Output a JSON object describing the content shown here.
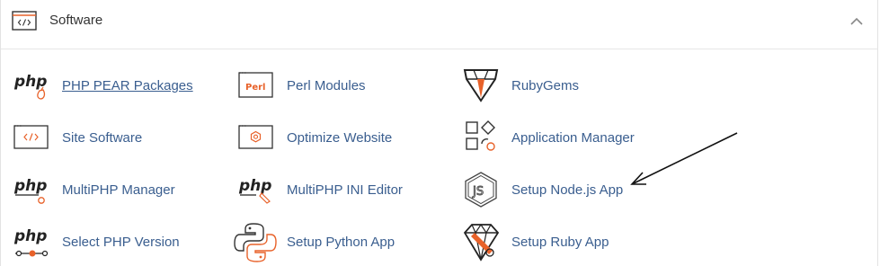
{
  "section": {
    "title": "Software",
    "icon": "code-window-icon",
    "collapse_icon": "chevron-up-icon"
  },
  "colors": {
    "link": "#3a5e8f",
    "accent": "#e8622a",
    "icon_dark": "#333333"
  },
  "items": [
    {
      "label": "PHP PEAR Packages",
      "icon": "php-pear-icon"
    },
    {
      "label": "Perl Modules",
      "icon": "perl-icon",
      "icon_text": "Perl"
    },
    {
      "label": "RubyGems",
      "icon": "rubygems-icon"
    },
    {
      "label": "Site Software",
      "icon": "site-software-icon"
    },
    {
      "label": "Optimize Website",
      "icon": "optimize-website-icon"
    },
    {
      "label": "Application Manager",
      "icon": "application-manager-icon"
    },
    {
      "label": "MultiPHP Manager",
      "icon": "multiphp-manager-icon"
    },
    {
      "label": "MultiPHP INI Editor",
      "icon": "multiphp-ini-icon"
    },
    {
      "label": "Setup Node.js App",
      "icon": "nodejs-icon"
    },
    {
      "label": "Select PHP Version",
      "icon": "select-php-icon"
    },
    {
      "label": "Setup Python App",
      "icon": "python-icon"
    },
    {
      "label": "Setup Ruby App",
      "icon": "ruby-app-icon"
    }
  ],
  "php_glyph": "php",
  "node_glyph": "JS",
  "annotation": {
    "icon": "arrow-annotation-icon"
  }
}
